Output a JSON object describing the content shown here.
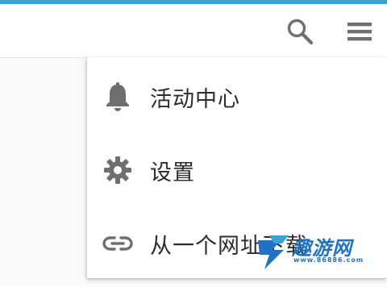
{
  "toolbar": {
    "search_icon": "search-icon",
    "menu_icon": "hamburger-menu-icon"
  },
  "dropdown": {
    "items": [
      {
        "label": "活动中心",
        "icon": "bell-icon"
      },
      {
        "label": "设置",
        "icon": "gear-icon"
      },
      {
        "label": "从一个网址下载",
        "icon": "link-icon"
      }
    ]
  },
  "watermark": {
    "text": "趣游网",
    "url": "www.86886.com"
  },
  "colors": {
    "accent": "#36a3d9",
    "icon": "#6f6f6f",
    "text": "#2c2c2c",
    "watermark": "#1e73c8"
  }
}
